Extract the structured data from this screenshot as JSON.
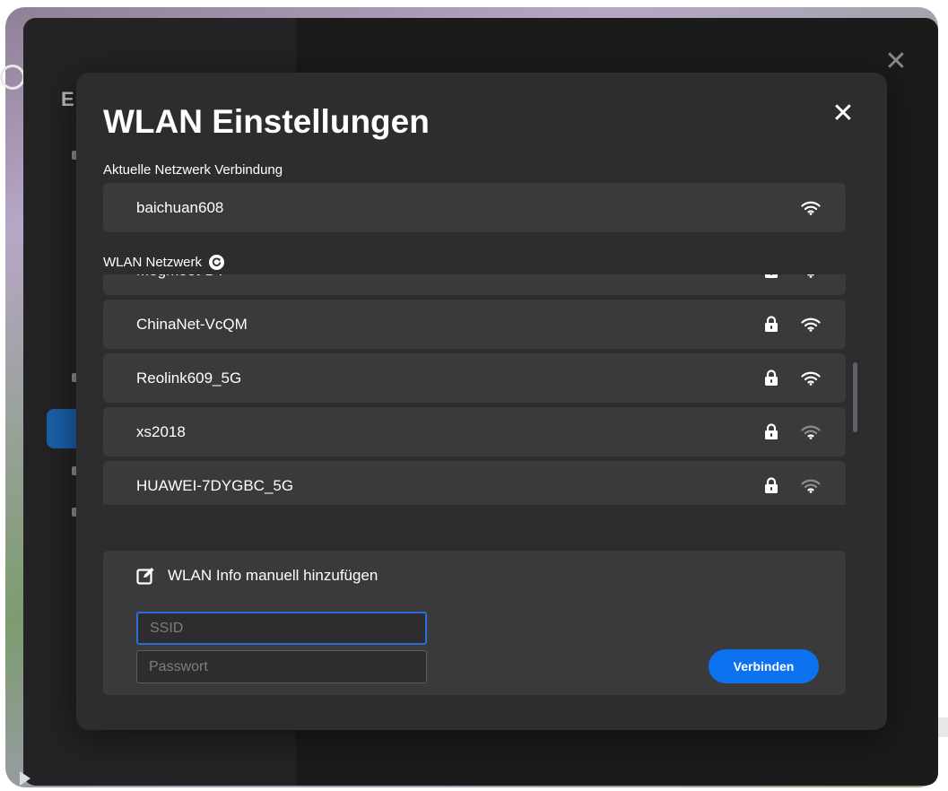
{
  "modal": {
    "title": "WLAN Einstellungen",
    "close_label": "✕"
  },
  "outer": {
    "close_label": "✕",
    "letter": "E"
  },
  "current_connection": {
    "label": "Aktuelle Netzwerk Verbindung",
    "ssid": "baichuan608",
    "icon": "wifi-icon"
  },
  "networks": {
    "label": "WLAN Netzwerk",
    "refresh_icon": "refresh-icon",
    "items": [
      {
        "ssid": "Megmeet-DT",
        "secured": true,
        "signal": "strong"
      },
      {
        "ssid": "ChinaNet-VcQM",
        "secured": true,
        "signal": "strong"
      },
      {
        "ssid": "Reolink609_5G",
        "secured": true,
        "signal": "strong"
      },
      {
        "ssid": "xs2018",
        "secured": true,
        "signal": "medium"
      },
      {
        "ssid": "HUAWEI-7DYGBC_5G",
        "secured": true,
        "signal": "medium"
      }
    ]
  },
  "manual": {
    "title": "WLAN Info manuell hinzufügen",
    "icon": "edit-icon",
    "ssid_placeholder": "SSID",
    "ssid_value": "",
    "password_placeholder": "Passwort",
    "password_value": "",
    "connect_label": "Verbinden"
  },
  "colors": {
    "modal_bg": "#2d2d2f",
    "row_bg": "#3a3a3c",
    "accent": "#0c72f0",
    "focus_border": "#2a6ed6"
  }
}
